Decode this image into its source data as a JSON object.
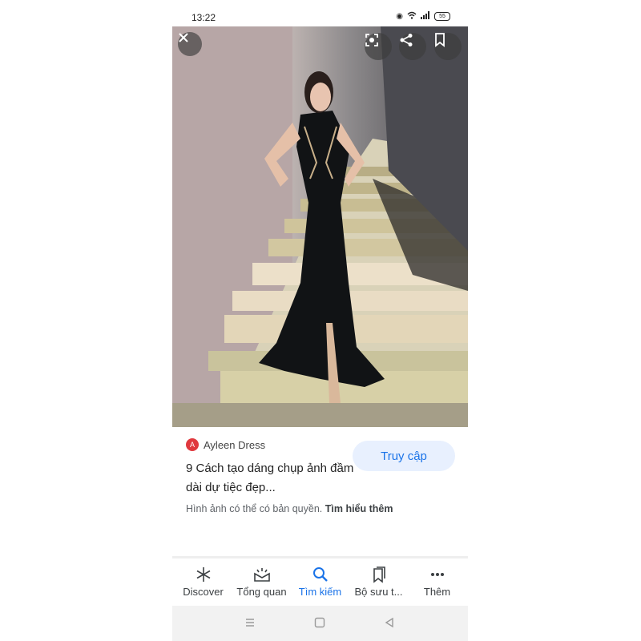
{
  "status": {
    "time": "13:22",
    "battery": "55"
  },
  "viewer": {
    "close_icon": "close-icon",
    "lens_icon": "lens-icon",
    "share_icon": "share-icon",
    "save_icon": "bookmark-icon"
  },
  "result": {
    "source_logo": "A",
    "source_name": "Ayleen Dress",
    "title": "9 Cách tạo dáng chụp ảnh đầm dài dự tiệc đẹp...",
    "visit_label": "Truy cập",
    "copyright_text": "Hình ảnh có thể có bản quyền. ",
    "learn_more": "Tìm hiểu thêm"
  },
  "bottom_nav": {
    "items": [
      {
        "label": "Discover",
        "icon": "asterisk-icon"
      },
      {
        "label": "Tổng quan",
        "icon": "updates-icon"
      },
      {
        "label": "Tìm kiếm",
        "icon": "search-icon",
        "active": true
      },
      {
        "label": "Bộ sưu t...",
        "icon": "collections-icon"
      },
      {
        "label": "Thêm",
        "icon": "more-icon"
      }
    ]
  },
  "colors": {
    "accent": "#1a73e8",
    "visit_bg": "#e8f0fe",
    "source_logo": "#e0393e"
  }
}
